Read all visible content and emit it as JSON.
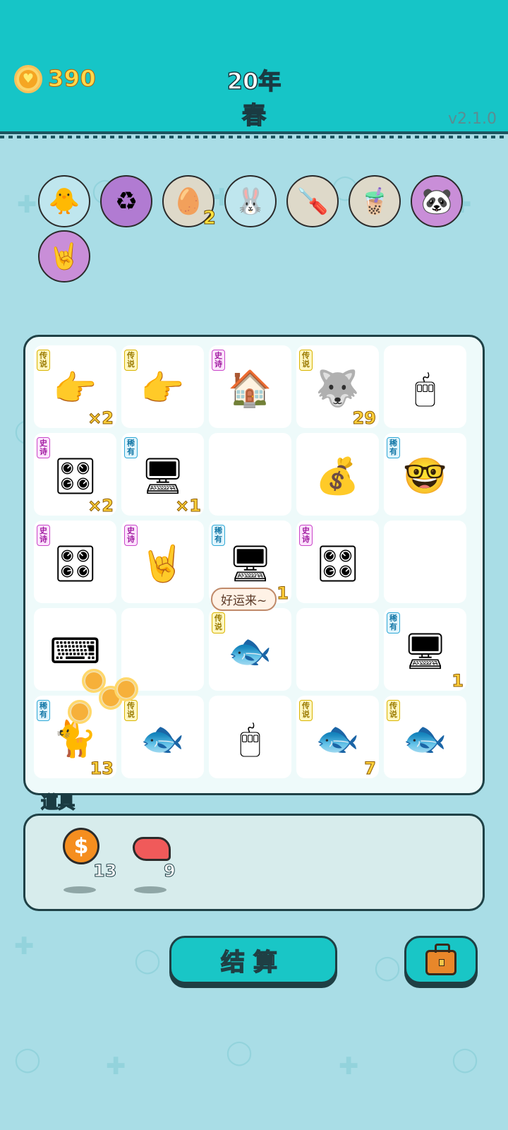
{
  "header": {
    "coins": "390",
    "year": "20年",
    "season": "春",
    "version": "v2.1.0"
  },
  "pets": [
    {
      "name": "chick-with-egg-icon",
      "glyph": "🐥",
      "bg": "#bfe6ee",
      "badge": ""
    },
    {
      "name": "recycle-icon",
      "glyph": "♻",
      "bg": "#b17bd2",
      "badge": ""
    },
    {
      "name": "egg-tray-icon",
      "glyph": "🥚",
      "bg": "#ded9c9",
      "badge": "2"
    },
    {
      "name": "rabbit-icon",
      "glyph": "🐰",
      "bg": "#bfe6ee",
      "badge": ""
    },
    {
      "name": "screwdriver-icon",
      "glyph": "🪛",
      "bg": "#ded9c9",
      "badge": ""
    },
    {
      "name": "bubble-tea-icon",
      "glyph": "🧋",
      "bg": "#ded9c9",
      "badge": ""
    },
    {
      "name": "panda-icon",
      "glyph": "🐼",
      "bg": "#c98ed8",
      "badge": ""
    },
    {
      "name": "rock-hand-icon",
      "glyph": "🤘",
      "bg": "#c98ed8",
      "badge": ""
    }
  ],
  "board": {
    "cells": [
      {
        "tag": "传说",
        "rarity": "legend",
        "icon": "pointing-hand-icon",
        "glyph": "👉",
        "count": "×2"
      },
      {
        "tag": "传说",
        "rarity": "legend",
        "icon": "pointing-hand-icon",
        "glyph": "👉",
        "count": ""
      },
      {
        "tag": "史诗",
        "rarity": "epic",
        "icon": "rabbit-house-icon",
        "glyph": "🏠",
        "count": ""
      },
      {
        "tag": "传说",
        "rarity": "legend",
        "icon": "crowned-husky-icon",
        "glyph": "🐺",
        "count": "29"
      },
      {
        "tag": "",
        "rarity": "",
        "icon": "mouse-icon",
        "glyph": "🖱",
        "count": ""
      },
      {
        "tag": "史诗",
        "rarity": "epic",
        "icon": "graphics-card-icon",
        "glyph": "🎛",
        "count": "×2"
      },
      {
        "tag": "稀有",
        "rarity": "rare",
        "icon": "computer-tower-icon",
        "glyph": "🖥",
        "count": "×1"
      },
      {
        "tag": "",
        "rarity": "",
        "icon": "",
        "glyph": "",
        "count": ""
      },
      {
        "tag": "",
        "rarity": "",
        "icon": "coin-pile-icon",
        "glyph": "💰",
        "count": ""
      },
      {
        "tag": "稀有",
        "rarity": "rare",
        "icon": "glasses-face-icon",
        "glyph": "🤓",
        "count": ""
      },
      {
        "tag": "史诗",
        "rarity": "epic",
        "icon": "graphics-card-icon",
        "glyph": "🎛",
        "count": ""
      },
      {
        "tag": "史诗",
        "rarity": "epic",
        "icon": "rock-hand-icon",
        "glyph": "🤘",
        "count": ""
      },
      {
        "tag": "稀有",
        "rarity": "rare",
        "icon": "computer-tower-icon",
        "glyph": "🖥",
        "count": "1"
      },
      {
        "tag": "史诗",
        "rarity": "epic",
        "icon": "graphics-card-icon",
        "glyph": "🎛",
        "count": ""
      },
      {
        "tag": "",
        "rarity": "",
        "icon": "",
        "glyph": "",
        "count": ""
      },
      {
        "tag": "",
        "rarity": "",
        "icon": "keyboard-icon",
        "glyph": "⌨",
        "count": ""
      },
      {
        "tag": "",
        "rarity": "",
        "icon": "",
        "glyph": "",
        "count": ""
      },
      {
        "tag": "传说",
        "rarity": "legend",
        "icon": "crowned-koi-icon",
        "glyph": "🐟",
        "count": ""
      },
      {
        "tag": "",
        "rarity": "",
        "icon": "",
        "glyph": "",
        "count": ""
      },
      {
        "tag": "稀有",
        "rarity": "rare",
        "icon": "computer-tower-icon",
        "glyph": "🖥",
        "count": "1"
      },
      {
        "tag": "稀有",
        "rarity": "rare",
        "icon": "grey-cat-icon",
        "glyph": "🐈",
        "count": "13"
      },
      {
        "tag": "传说",
        "rarity": "legend",
        "icon": "koi-fish-icon",
        "glyph": "🐟",
        "count": ""
      },
      {
        "tag": "",
        "rarity": "",
        "icon": "mouse-icon",
        "glyph": "🖱",
        "count": ""
      },
      {
        "tag": "传说",
        "rarity": "legend",
        "icon": "koi-fish-icon",
        "glyph": "🐟",
        "count": "7"
      },
      {
        "tag": "传说",
        "rarity": "legend",
        "icon": "koi-fish-icon",
        "glyph": "🐟",
        "count": ""
      }
    ],
    "speech": "好运来~"
  },
  "props": {
    "title": "道具",
    "items": [
      {
        "name": "dollar-coin-icon",
        "count": "13"
      },
      {
        "name": "liver-icon",
        "count": "9"
      }
    ]
  },
  "actions": {
    "settle_label": "结算",
    "bag_icon": "briefcase-icon"
  },
  "colors": {
    "header_bg": "#16c5c7",
    "page_bg": "#a9dde6",
    "button_bg": "#19c6c6",
    "legend_tag": "#d9b400",
    "epic_tag": "#c945c9",
    "rare_tag": "#2ea8d6"
  }
}
